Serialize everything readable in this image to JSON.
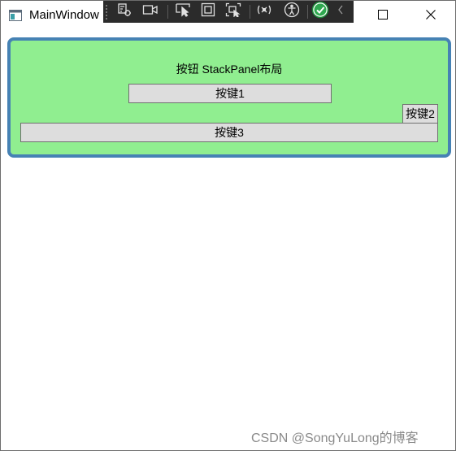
{
  "window": {
    "title": "MainWindow"
  },
  "toolbar": {
    "icons": [
      "select-element-icon",
      "record-icon",
      "pointer-select-icon",
      "display-layout-icon",
      "track-focus-icon",
      "hot-reload-icon",
      "accessibility-icon",
      "check-icon",
      "collapse-icon"
    ]
  },
  "content": {
    "label": "按钮 StackPanel布局",
    "button1": "按键1",
    "button2": "按键2",
    "button3": "按键3"
  },
  "colors": {
    "panel_background": "#90ee90",
    "panel_border": "#4682b4",
    "button_background": "#dddddd"
  },
  "watermark": "CSDN @SongYuLong的博客"
}
